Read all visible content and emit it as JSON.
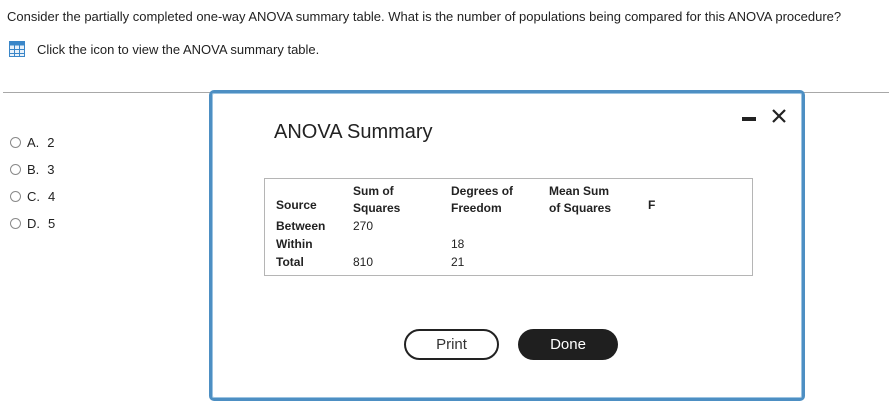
{
  "question": {
    "text": "Consider the partially completed one-way ANOVA summary table. What is the number of populations being compared for this ANOVA procedure?"
  },
  "hint": {
    "icon": "table-icon",
    "text": "Click the icon to view the ANOVA summary table."
  },
  "answers": [
    {
      "letter": "A.",
      "value": "2"
    },
    {
      "letter": "B.",
      "value": "3"
    },
    {
      "letter": "C.",
      "value": "4"
    },
    {
      "letter": "D.",
      "value": "5"
    }
  ],
  "modal": {
    "title": "ANOVA Summary",
    "table": {
      "headers": {
        "source": "Source",
        "ss_line1": "Sum of",
        "ss_line2": "Squares",
        "df_line1": "Degrees of",
        "df_line2": "Freedom",
        "ms_line1": "Mean Sum",
        "ms_line2": "of Squares",
        "f": "F"
      },
      "rows": [
        {
          "source": "Between",
          "ss": "270",
          "df": "",
          "ms": "",
          "f": ""
        },
        {
          "source": "Within",
          "ss": "",
          "df": "18",
          "ms": "",
          "f": ""
        },
        {
          "source": "Total",
          "ss": "810",
          "df": "21",
          "ms": "",
          "f": ""
        }
      ]
    },
    "buttons": {
      "print": "Print",
      "done": "Done"
    }
  },
  "colors": {
    "modal_border": "#4d8fc3",
    "done_bg": "#1f1f1f",
    "icon_blue": "#3a86c8"
  }
}
